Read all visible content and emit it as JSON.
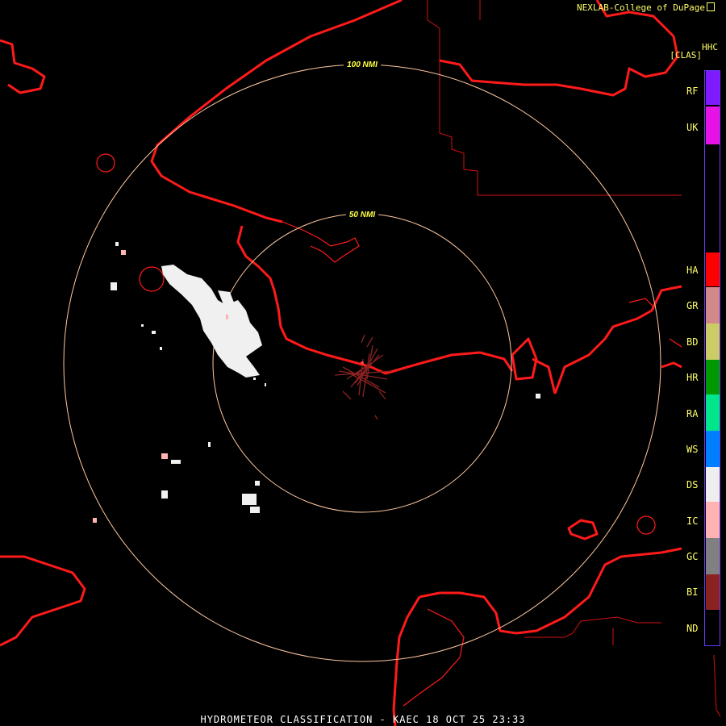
{
  "credit": "NEXLAB-College of DuPage",
  "product_code": "HHC",
  "mode": "[CLAS]",
  "range_rings": [
    {
      "label": "100 NMI",
      "color": "#ffffff"
    },
    {
      "label": "50 NMI",
      "color": "#ffffff"
    }
  ],
  "legend": [
    {
      "code": "RF",
      "color": "#7f1aff"
    },
    {
      "code": "UK",
      "color": "#e612e6"
    },
    {
      "code": "HA",
      "color": "#ff0000"
    },
    {
      "code": "GR",
      "color": "#d08a8a"
    },
    {
      "code": "BD",
      "color": "#cccc66"
    },
    {
      "code": "HR",
      "color": "#009900"
    },
    {
      "code": "RA",
      "color": "#00e68a"
    },
    {
      "code": "WS",
      "color": "#0080ff"
    },
    {
      "code": "DS",
      "color": "#eeeeee"
    },
    {
      "code": "IC",
      "color": "#ffb3b3"
    },
    {
      "code": "GC",
      "color": "#808080"
    },
    {
      "code": "BI",
      "color": "#8b2222"
    },
    {
      "code": "ND",
      "color": "#000000"
    }
  ],
  "footer": "HYDROMETEOR CLASSIFICATION - KAEC 18 OCT 25 23:33",
  "colors": {
    "coast": "#ff1a1a",
    "border": "#d01010",
    "ring": "#ffc8a0",
    "ring_label": "#ffff44"
  }
}
